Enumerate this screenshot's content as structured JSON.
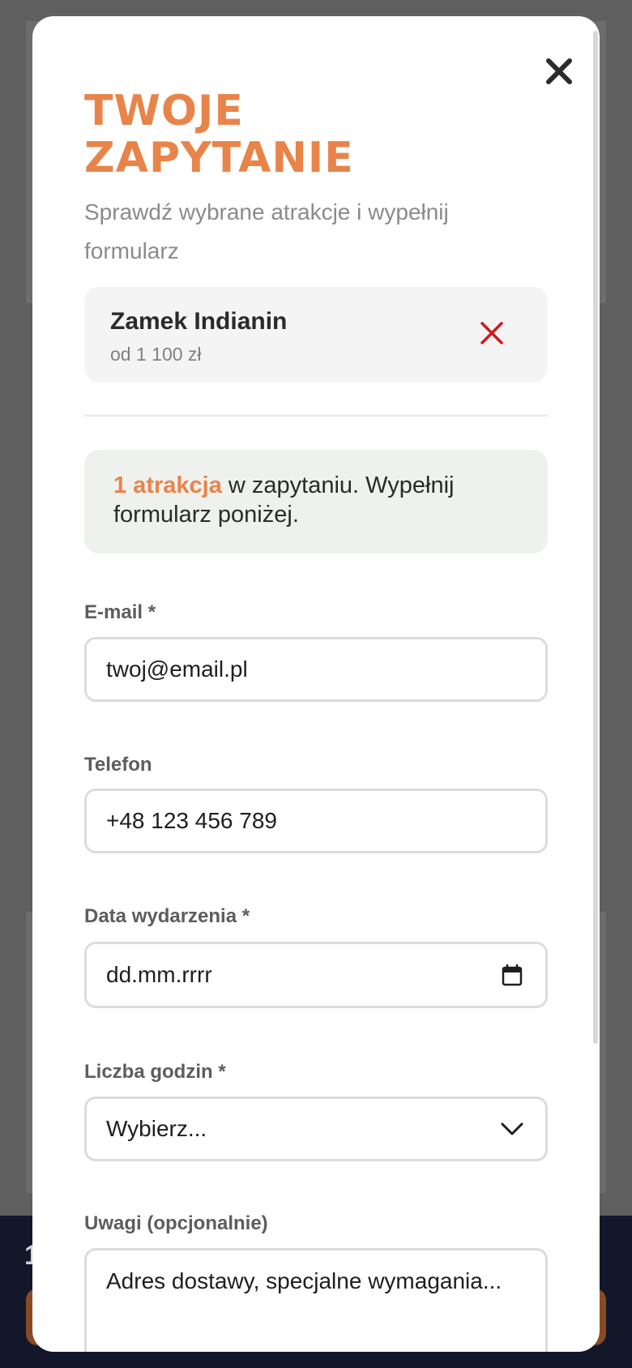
{
  "background": {
    "footer_text": "1"
  },
  "modal": {
    "title": "TWOJE ZAPYTANIE",
    "subtitle": "Sprawdź wybrane atrakcje i wypełnij formularz",
    "close_icon": "close-icon",
    "selected_items": [
      {
        "name": "Zamek Indianin",
        "price": "od 1 100 zł",
        "remove_icon": "remove-x-icon"
      }
    ],
    "info": {
      "count_text": "1 atrakcja",
      "rest_text": " w zapytaniu. Wypełnij formularz poniżej."
    },
    "form": {
      "email": {
        "label": "E-mail *",
        "placeholder": "twoj@email.pl"
      },
      "phone": {
        "label": "Telefon",
        "placeholder": "+48 123 456 789"
      },
      "date": {
        "label": "Data wydarzenia *",
        "placeholder": "dd.mm.rrrr",
        "icon": "calendar-icon"
      },
      "hours": {
        "label": "Liczba godzin *",
        "selected": "Wybierz...",
        "icon": "chevron-down-icon"
      },
      "notes": {
        "label": "Uwagi (opcjonalnie)",
        "placeholder": "Adres dostawy, specjalne wymagania..."
      }
    }
  },
  "colors": {
    "accent": "#e8844a",
    "remove": "#cc1b1b",
    "info_bg": "#eff1ee"
  }
}
